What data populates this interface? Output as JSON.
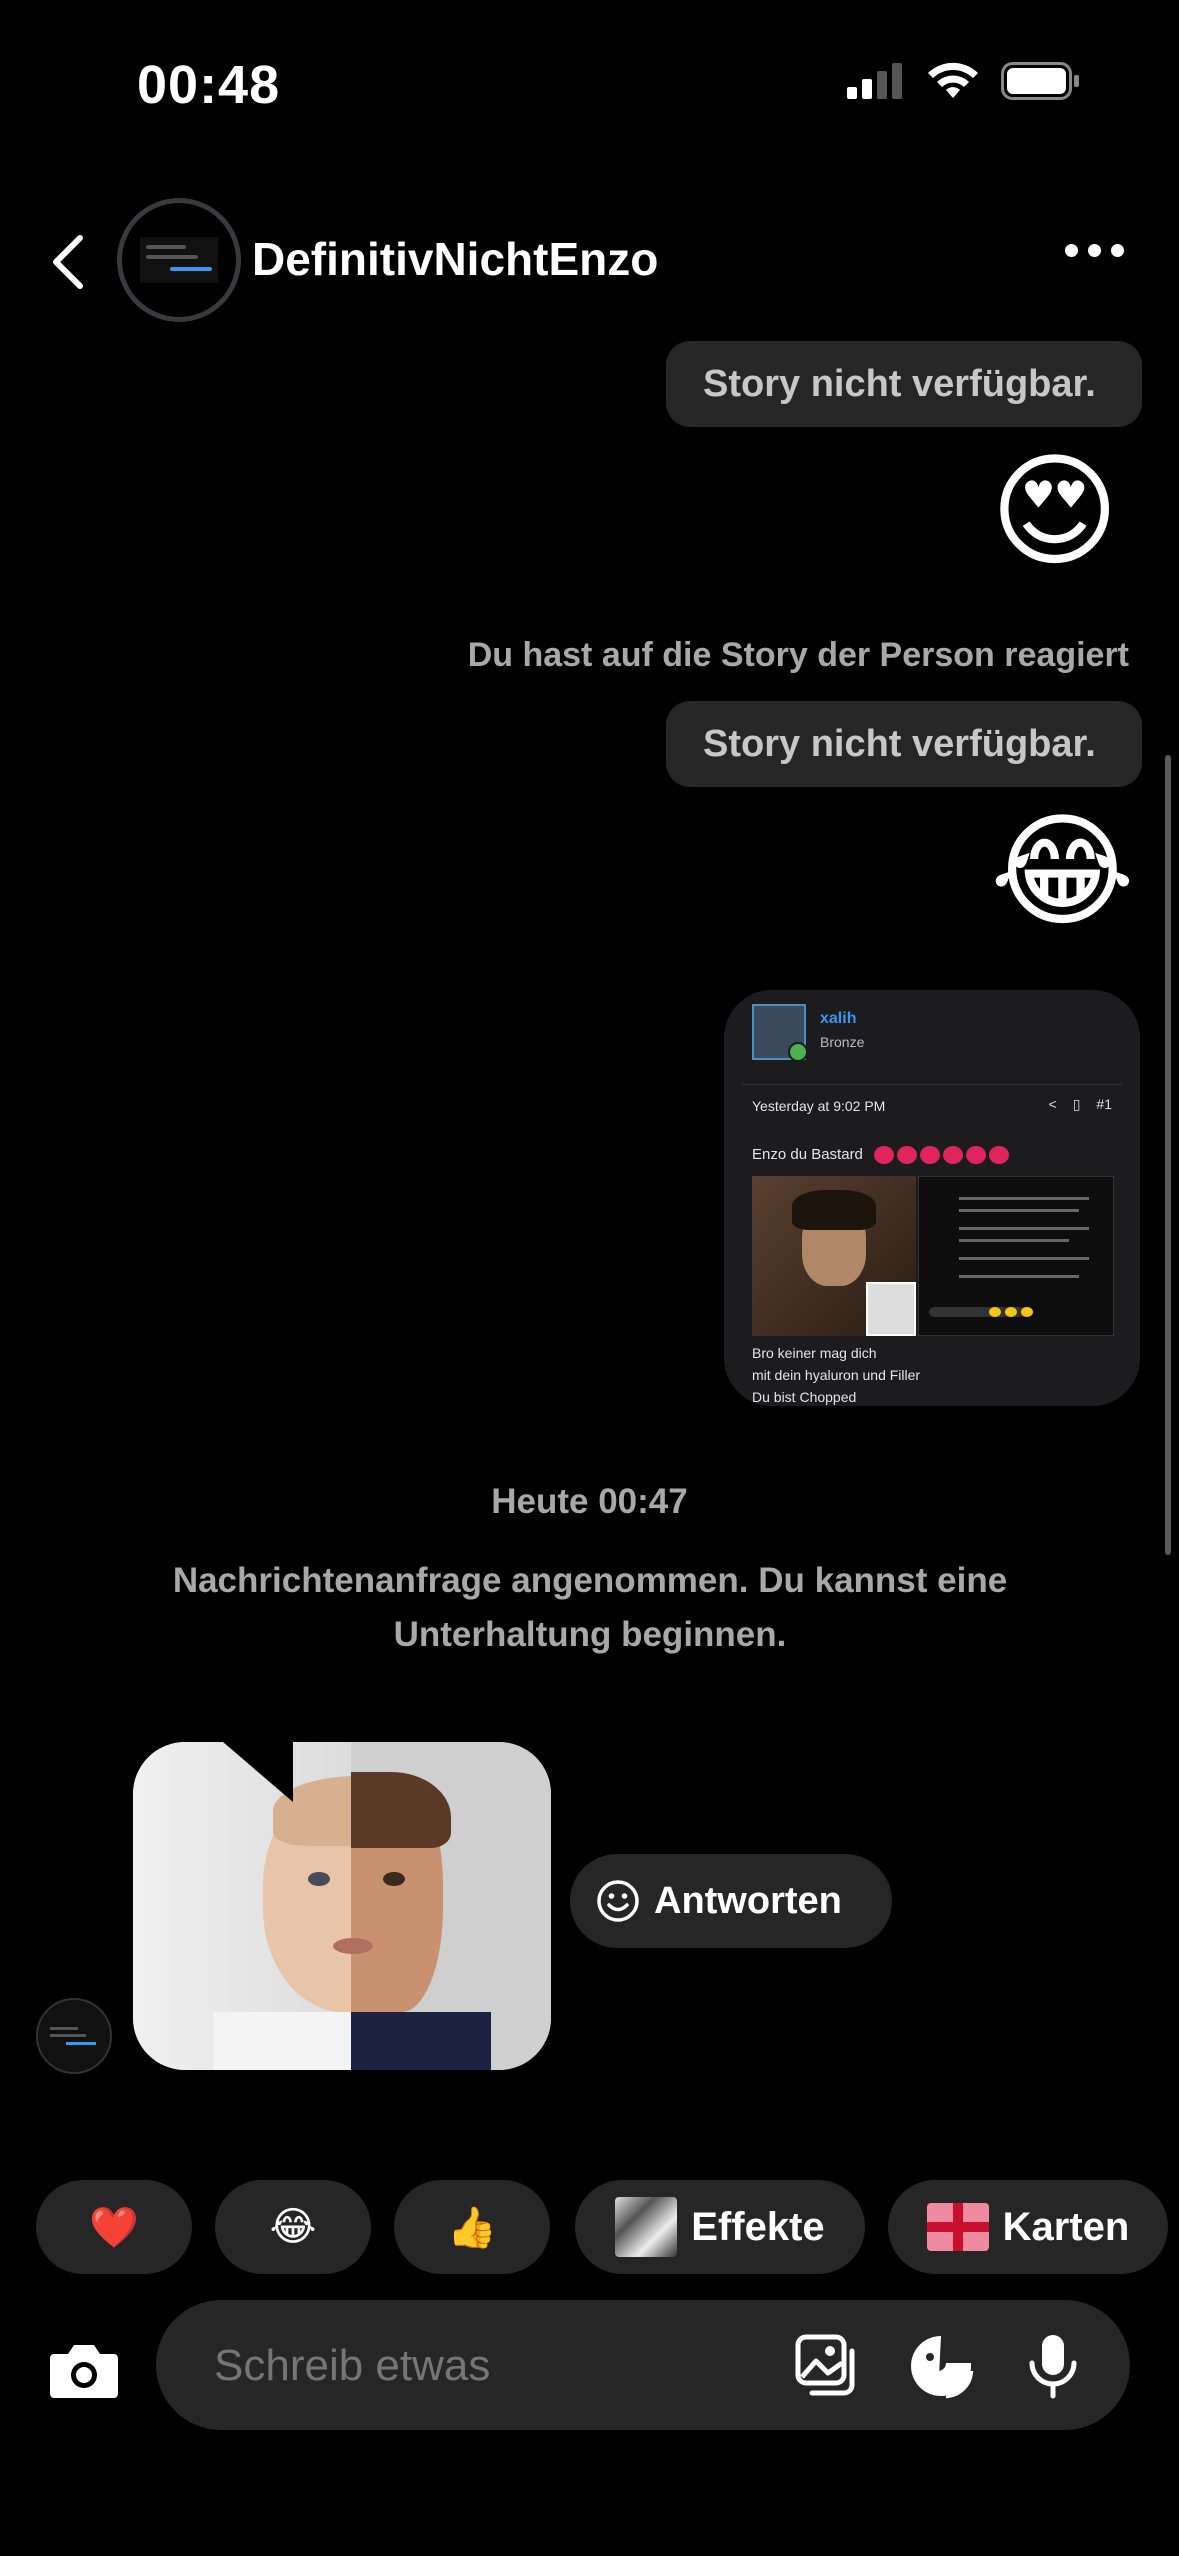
{
  "status_bar": {
    "time": "00:48"
  },
  "header": {
    "username": "DefinitivNichtEnzo"
  },
  "messages": {
    "story_unavailable_1": "Story nicht verfügbar.",
    "reaction_1": "😍",
    "reacted_to_story": "Du hast auf die Story der Person reagiert",
    "story_unavailable_2": "Story nicht verfügbar.",
    "reaction_2": "😂"
  },
  "shared_post": {
    "username": "xalih",
    "rank": "Bronze",
    "timestamp": "Yesterday at 9:02 PM",
    "post_number": "#1",
    "title": "Enzo du Bastard",
    "caption_lines": [
      "Bro keiner mag dich",
      "mit dein hyaluron und Filler",
      "Du bist Chopped"
    ]
  },
  "date_separator": "Heute 00:47",
  "request_accepted": "Nachrichtenanfrage angenommen. Du kannst eine Unterhaltung beginnen.",
  "reply_button": "Antworten",
  "quick_reactions": {
    "heart": "❤️",
    "laugh": "😂",
    "thumbs": "👍",
    "effects_label": "Effekte",
    "cards_label": "Karten"
  },
  "composer": {
    "placeholder": "Schreib etwas"
  },
  "colors": {
    "background": "#000000",
    "bubble": "#262626",
    "muted_text": "#a8a8a8",
    "link_blue": "#3897f0"
  }
}
